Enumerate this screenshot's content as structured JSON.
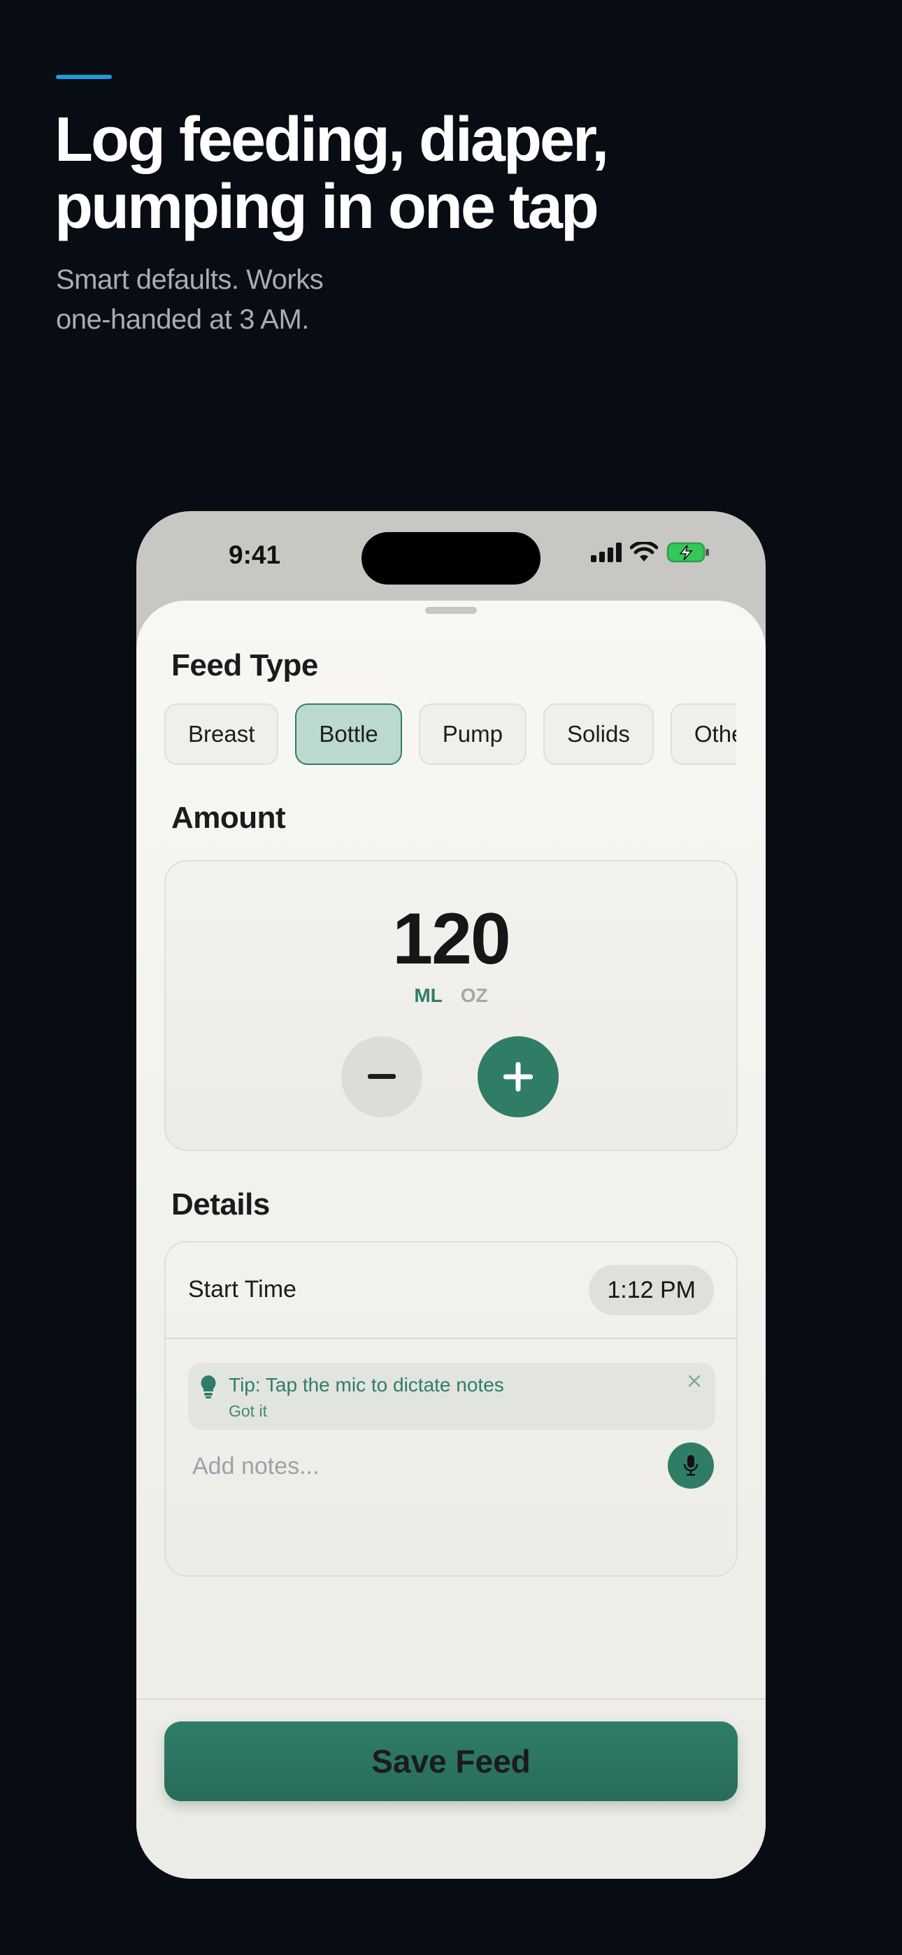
{
  "marketing": {
    "headline_line1": "Log feeding, diaper,",
    "headline_line2": "pumping in one tap",
    "subhead_line1": "Smart defaults. Works",
    "subhead_line2": "one-handed at 3 AM.",
    "accent_color": "#1a9be6"
  },
  "status_bar": {
    "time": "9:41",
    "icons": [
      "cellular-signal-icon",
      "wifi-icon",
      "battery-charging-icon"
    ]
  },
  "feed_type": {
    "title": "Feed Type",
    "options": [
      "Breast",
      "Bottle",
      "Pump",
      "Solids",
      "Other"
    ],
    "selected": "Bottle"
  },
  "amount": {
    "title": "Amount",
    "value": "120",
    "unit_ml": "ML",
    "unit_oz": "OZ",
    "selected_unit": "ML",
    "decrement_icon": "minus-icon",
    "increment_icon": "plus-icon"
  },
  "details": {
    "title": "Details",
    "start_time_label": "Start Time",
    "start_time_value": "1:12 PM",
    "tip_text": "Tip: Tap the mic to dictate notes",
    "tip_dismiss": "Got it",
    "notes_placeholder": "Add notes..."
  },
  "actions": {
    "save_label": "Save Feed"
  },
  "colors": {
    "brand_green": "#2f7d67",
    "selected_chip_bg": "#bcd9cf",
    "battery_green": "#34c759"
  }
}
